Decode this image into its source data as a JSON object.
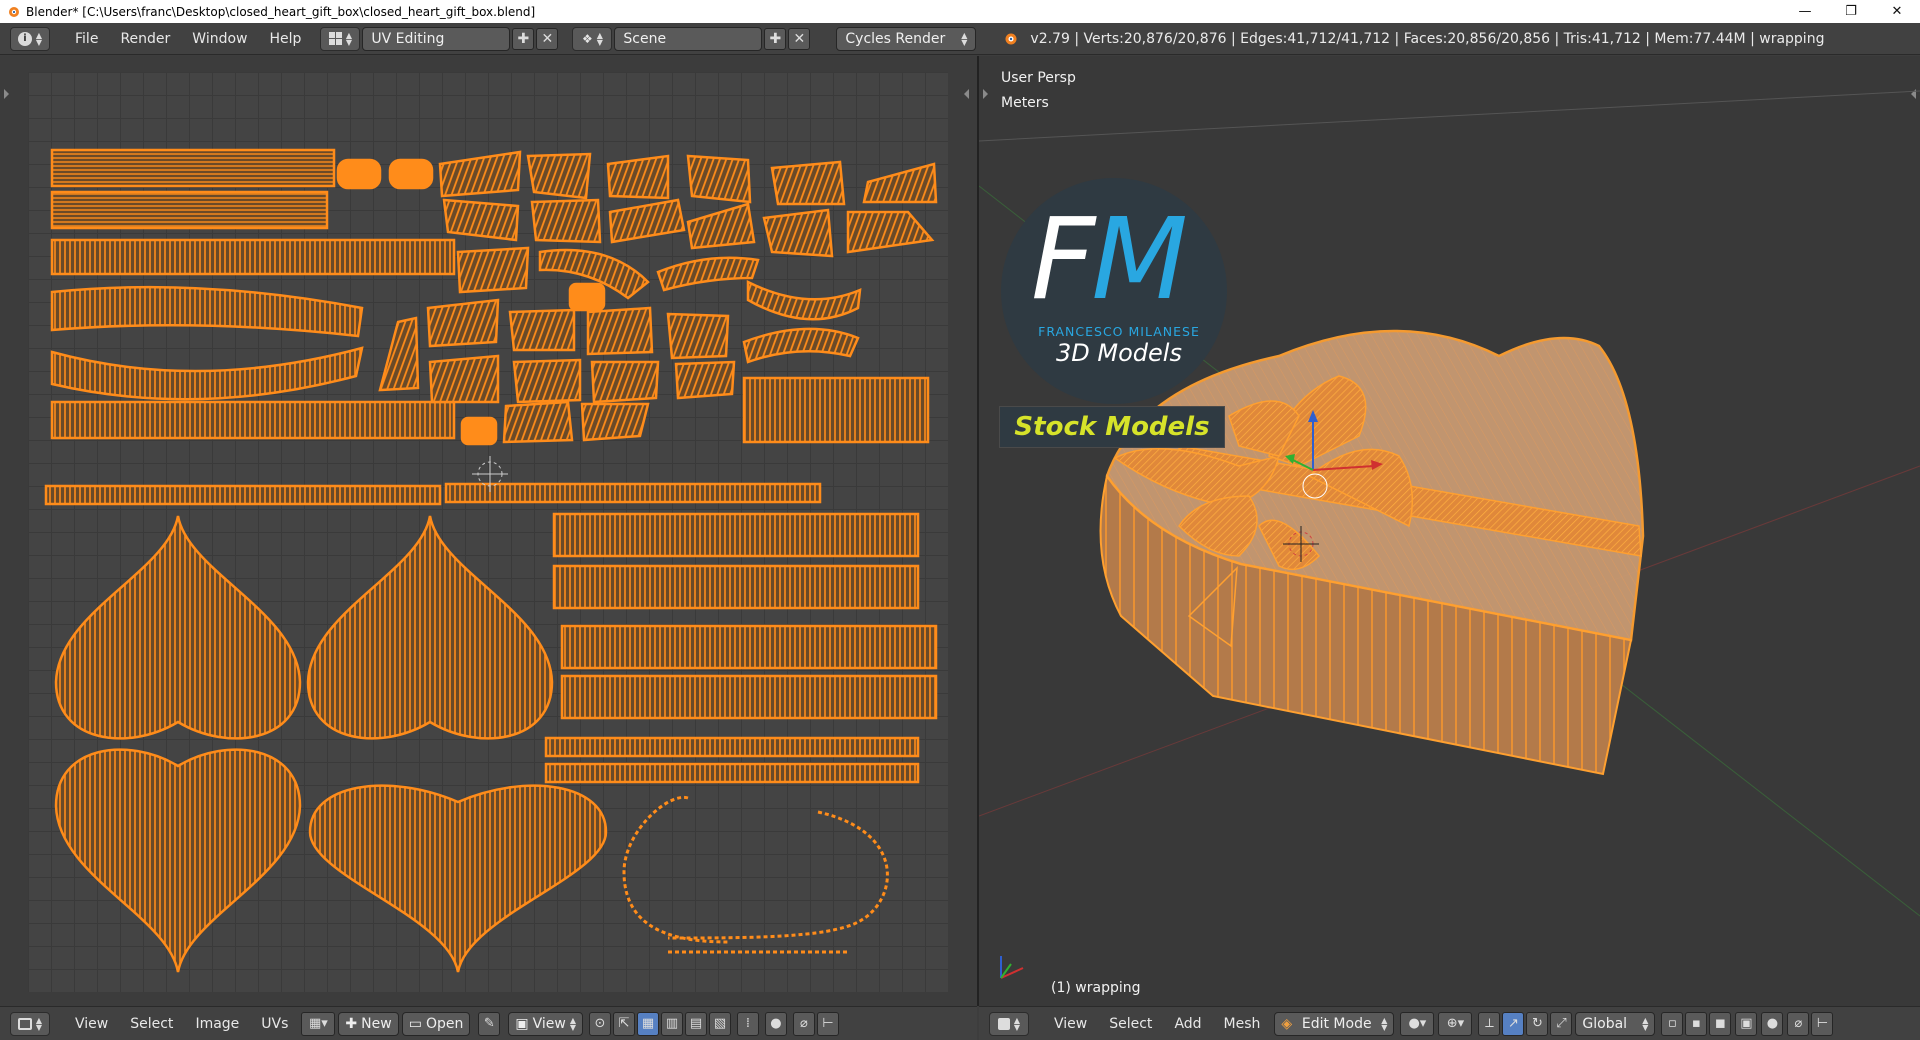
{
  "window": {
    "title": "Blender* [C:\\Users\\franc\\Desktop\\closed_heart_gift_box\\closed_heart_gift_box.blend]",
    "minimize": "—",
    "restore": "❐",
    "close": "✕"
  },
  "info_header": {
    "menus": [
      "File",
      "Render",
      "Window",
      "Help"
    ],
    "screen_layout": "UV Editing",
    "scene": "Scene",
    "render_engine": "Cycles Render",
    "stats": "v2.79 | Verts:20,876/20,876 | Edges:41,712/41,712 | Faces:20,856/20,856 | Tris:41,712 | Mem:77.44M | wrapping"
  },
  "uv_editor": {
    "footer_menus": [
      "View",
      "Select",
      "Image",
      "UVs"
    ],
    "new_label": "New",
    "open_label": "Open",
    "view_label": "View"
  },
  "viewport": {
    "view_name": "User Persp",
    "units": "Meters",
    "object_label": "(1) wrapping",
    "footer_menus": [
      "View",
      "Select",
      "Add",
      "Mesh"
    ],
    "mode": "Edit Mode",
    "orientation": "Global"
  },
  "logo": {
    "letter_f": "F",
    "letter_m": "M",
    "name": "FRANCESCO MILANESE",
    "tagline": "3D Models",
    "badge": "Stock Models"
  },
  "colors": {
    "uv_orange": "#ff8c1a",
    "selection_orange": "#ffa030",
    "logo_blue": "#29a7e1",
    "badge_yellow": "#d6e32a"
  }
}
